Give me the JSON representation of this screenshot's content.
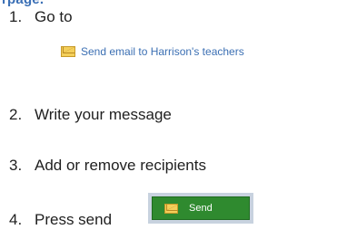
{
  "heading_fragment": "rpage.",
  "steps": [
    {
      "number": "1.",
      "text": "Go to"
    },
    {
      "number": "2.",
      "text": "Write your message"
    },
    {
      "number": "3.",
      "text": "Add or remove recipients"
    },
    {
      "number": "4.",
      "text": "Press send"
    }
  ],
  "email_link": {
    "label": "Send email to Harrison's teachers",
    "icon": "envelope-icon"
  },
  "send_button": {
    "label": "Send",
    "icon": "envelope-icon",
    "color": "#2f8a2f"
  }
}
